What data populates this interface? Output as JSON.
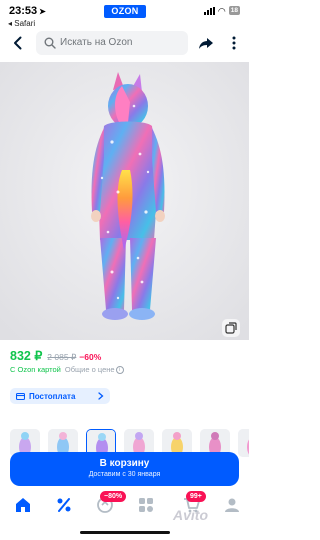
{
  "status_bar": {
    "time": "23:53",
    "back_app": "◂ Safari",
    "url_logo": "OZON",
    "battery": "18"
  },
  "search": {
    "placeholder": "Искать на Ozon"
  },
  "product": {
    "price": "832 ₽",
    "old_price": "2 085 ₽",
    "discount": "−60%",
    "ozon_card_price_label": "С Ozon картой",
    "price_info_link": "Общие о цене",
    "postpay_label": "Постоплата",
    "thumbnail_count": 7,
    "active_thumbnail_index": 3
  },
  "cart": {
    "label": "В корзину",
    "delivery": "Доставим с 30 января"
  },
  "tabbar": {
    "items": [
      "home",
      "discounts",
      "catalog",
      "cart",
      "profile"
    ],
    "discount_badge": "−80%",
    "cart_badge": "99+"
  },
  "watermark": "Avito",
  "colors": {
    "brand": "#005bff",
    "price_green": "#10c44c",
    "discount_red": "#f91155",
    "muted": "#99a3ae"
  }
}
